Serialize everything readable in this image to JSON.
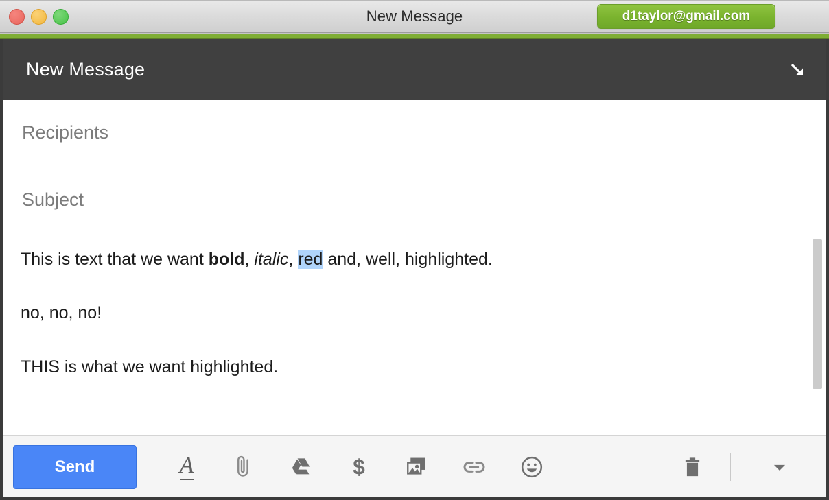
{
  "window": {
    "title": "New Message",
    "traffic_lights": [
      "close",
      "minimize",
      "zoom"
    ],
    "account_badge": "d1taylor@gmail.com",
    "accent_color": "#7fae35"
  },
  "compose": {
    "header_title": "New Message",
    "expand_icon": "arrow-down-right-icon",
    "header_bg": "#404040",
    "fields": {
      "recipients": {
        "placeholder": "Recipients",
        "value": ""
      },
      "subject": {
        "placeholder": "Subject",
        "value": ""
      }
    },
    "body": {
      "paragraphs": [
        {
          "runs": [
            {
              "text": "This is text that we want ",
              "style": "normal"
            },
            {
              "text": "bold",
              "style": "bold"
            },
            {
              "text": ", ",
              "style": "normal"
            },
            {
              "text": "italic",
              "style": "italic"
            },
            {
              "text": ", ",
              "style": "normal"
            },
            {
              "text": "red",
              "style": "selected"
            },
            {
              "text": " and, well, highlighted.",
              "style": "normal"
            }
          ]
        },
        {
          "runs": [
            {
              "text": "no, no, no!",
              "style": "normal"
            }
          ]
        },
        {
          "runs": [
            {
              "text": "THIS is what we want highlighted.",
              "style": "normal"
            }
          ]
        }
      ],
      "selection_color": "#b0d4fb"
    }
  },
  "toolbar": {
    "send_label": "Send",
    "send_color": "#4a86f7",
    "icons": [
      {
        "name": "format-text-icon",
        "glyph": "A"
      },
      {
        "name": "attach-file-icon",
        "glyph": "paperclip"
      },
      {
        "name": "google-drive-icon",
        "glyph": "drive"
      },
      {
        "name": "insert-money-icon",
        "glyph": "$"
      },
      {
        "name": "insert-photo-icon",
        "glyph": "photo"
      },
      {
        "name": "insert-link-icon",
        "glyph": "link"
      },
      {
        "name": "insert-emoji-icon",
        "glyph": "emoji"
      }
    ],
    "discard_icon": "trash-icon",
    "more-options_icon": "chevron-down-icon"
  }
}
